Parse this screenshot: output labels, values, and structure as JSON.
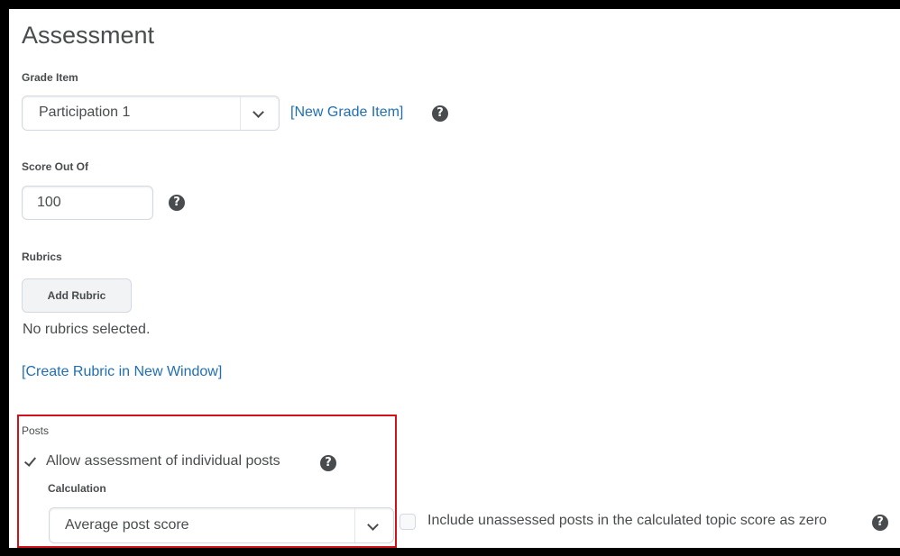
{
  "section": {
    "title": "Assessment"
  },
  "grade_item": {
    "label": "Grade Item",
    "selected": "Participation 1",
    "new_link": "[New Grade Item]",
    "help_icon": "question-circle-icon"
  },
  "score": {
    "label": "Score Out Of",
    "value": "100",
    "help_icon": "question-circle-icon"
  },
  "rubrics": {
    "label": "Rubrics",
    "add_button": "Add Rubric",
    "status": "No rubrics selected.",
    "create_link": "[Create Rubric in New Window]"
  },
  "posts": {
    "label": "Posts",
    "allow_label": "Allow assessment of individual posts",
    "allow_checked": true,
    "calculation_label": "Calculation",
    "calculation_selected": "Average post score",
    "include_label": "Include unassessed posts in the calculated topic score as zero",
    "include_checked": false,
    "highlight_color": "#d0121b"
  },
  "icons": {
    "help_glyph": "?",
    "dropdown": "chevron-down-icon",
    "check": "check-icon"
  },
  "colors": {
    "link": "#1f6fb2",
    "text": "#494c4e",
    "background": "#ffffff"
  }
}
